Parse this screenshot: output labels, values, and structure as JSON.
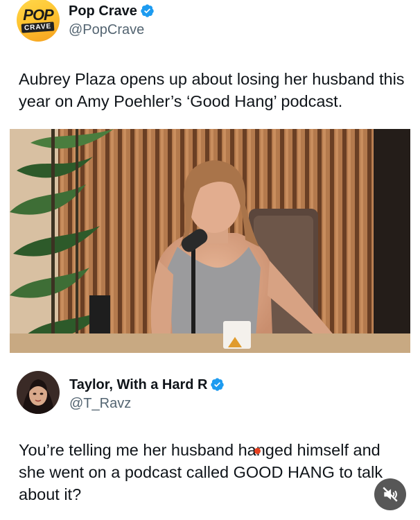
{
  "colors": {
    "verified": "#1d9bf0",
    "handle": "#536471",
    "text": "#0f1419",
    "accent_dot": "#e8401f"
  },
  "tweet": {
    "logo_pop": "POP",
    "logo_crave": "CRAVE",
    "name": "Pop Crave",
    "handle": "@PopCrave",
    "verified_icon": "verified-badge-icon",
    "text": "Aubrey Plaza opens up about losing her husband this year on Amy Poehler’s ‘Good Hang’ podcast."
  },
  "media": {
    "icon": "video-thumbnail"
  },
  "reply": {
    "name": "Taylor, With a Hard R",
    "handle": "@T_Ravz",
    "verified_icon": "verified-badge-icon",
    "text": "You’re telling me her husband hanged himself and she went on a podcast called GOOD HANG to talk about it?"
  },
  "controls": {
    "mute_icon": "sound-off-icon"
  }
}
